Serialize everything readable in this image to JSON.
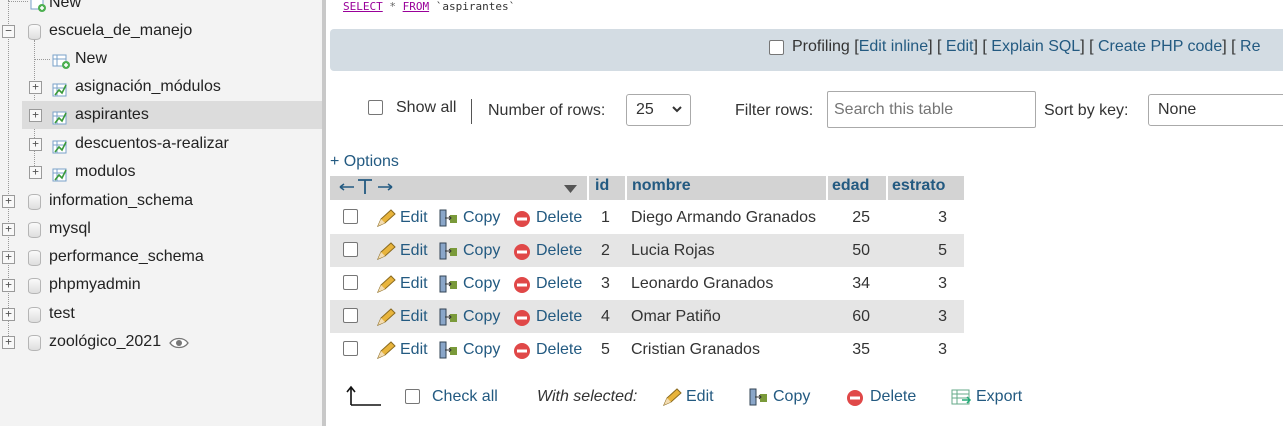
{
  "sidebar": {
    "top_new": "New",
    "db_escuela": "escuela_de_manejo",
    "new": "New",
    "tables": [
      "asignación_módulos",
      "aspirantes",
      "descuentos-a-realizar",
      "modulos"
    ],
    "dbs": [
      "information_schema",
      "mysql",
      "performance_schema",
      "phpmyadmin",
      "test",
      "zoológico_2021"
    ]
  },
  "sql": {
    "kw_select": "SELECT",
    "star": "*",
    "kw_from": "FROM",
    "table": "`aspirantes`"
  },
  "sqlbar": {
    "profiling": "Profiling",
    "edit_inline": "Edit inline",
    "edit": "Edit",
    "explain": "Explain SQL",
    "php": "Create PHP code",
    "refresh": "Re",
    "br_open": "[",
    "sep": "] [",
    "br_close": "]"
  },
  "controls": {
    "show_all": "Show all",
    "rows_label": "Number of rows:",
    "rows_value": "25",
    "filter_label": "Filter rows:",
    "filter_placeholder": "Search this table",
    "sort_label": "Sort by key:",
    "sort_value": "None"
  },
  "options": "+ Options",
  "columns": [
    "id",
    "nombre",
    "edad",
    "estrato"
  ],
  "row_actions": {
    "edit": "Edit",
    "copy": "Copy",
    "delete": "Delete"
  },
  "rows": [
    {
      "id": "1",
      "nombre": "Diego Armando Granados",
      "edad": "25",
      "estrato": "3"
    },
    {
      "id": "2",
      "nombre": "Lucia Rojas",
      "edad": "50",
      "estrato": "5"
    },
    {
      "id": "3",
      "nombre": "Leonardo Granados",
      "edad": "34",
      "estrato": "3"
    },
    {
      "id": "4",
      "nombre": "Omar Patiño",
      "edad": "60",
      "estrato": "3"
    },
    {
      "id": "5",
      "nombre": "Cristian Granados",
      "edad": "35",
      "estrato": "3"
    }
  ],
  "footer": {
    "check_all": "Check all",
    "with_selected": "With selected:",
    "edit": "Edit",
    "copy": "Copy",
    "delete": "Delete",
    "export": "Export"
  },
  "colors": {
    "link": "#235a81",
    "row_alt": "#e5e5e5",
    "header": "#d3d3d3",
    "sql_bar": "#d3dce3"
  }
}
